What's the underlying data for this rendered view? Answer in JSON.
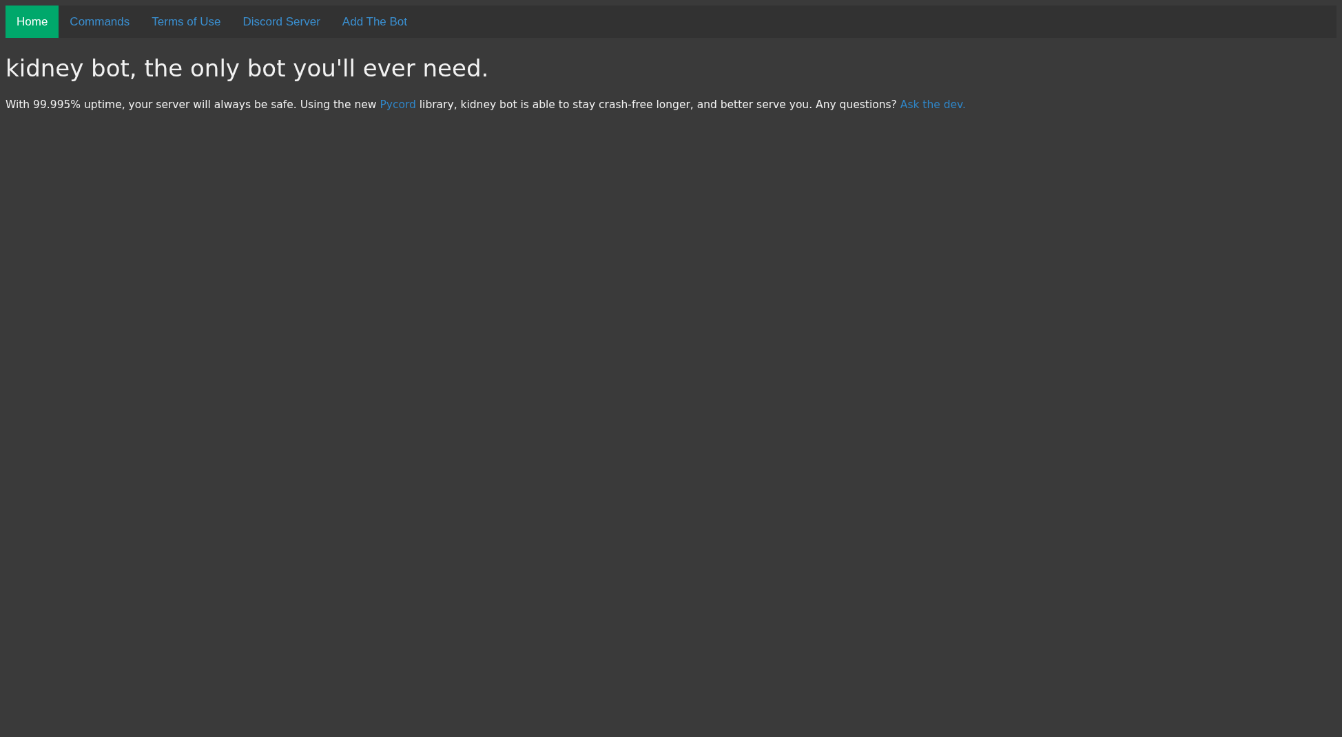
{
  "nav": [
    {
      "label": "Home",
      "selected": true
    },
    {
      "label": "Commands",
      "selected": false
    },
    {
      "label": "Terms of Use",
      "selected": false
    },
    {
      "label": "Discord Server",
      "selected": false
    },
    {
      "label": "Add The Bot",
      "selected": false
    }
  ],
  "heading": "kidney bot, the only bot you'll ever need.",
  "paragraph": [
    {
      "kind": "text",
      "text": "With 99.995% uptime, your server will always be safe. Using the new "
    },
    {
      "kind": "link",
      "text": "Pycord"
    },
    {
      "kind": "text",
      "text": " library, kidney bot is able to stay crash-free longer, and better serve you. Any questions? "
    },
    {
      "kind": "link",
      "text": "Ask the dev."
    }
  ]
}
